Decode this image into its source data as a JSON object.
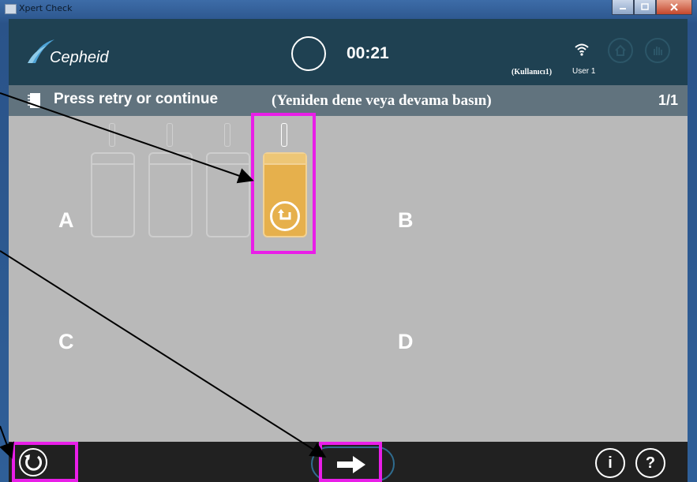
{
  "window": {
    "title": "Xpert Check"
  },
  "header": {
    "brand": "Cepheid",
    "timer": "00:21",
    "user_label": "(Kullanıcı1)",
    "user_name": "User 1",
    "home_icon": "home-icon",
    "hand_icon": "stop-hand-icon"
  },
  "banner": {
    "title": "Press retry or continue",
    "translation": "(Yeniden dene veya devama basın)",
    "page": "1/1"
  },
  "quadrants": {
    "a": "A",
    "b": "B",
    "c": "C",
    "d": "D"
  },
  "modules": [
    {
      "state": "inactive"
    },
    {
      "state": "inactive"
    },
    {
      "state": "inactive"
    },
    {
      "state": "retry",
      "icon": "retry-icon"
    }
  ],
  "footer": {
    "retry_icon": "refresh-icon",
    "continue_icon": "arrow-right-icon",
    "info_label": "i",
    "help_label": "?"
  },
  "colors": {
    "header_bg": "#1f4152",
    "banner_bg": "#61737e",
    "content_bg": "#b9b9b9",
    "module_active": "#e6b04c",
    "highlight": "#e91ee8",
    "footer_bg": "#212121"
  }
}
